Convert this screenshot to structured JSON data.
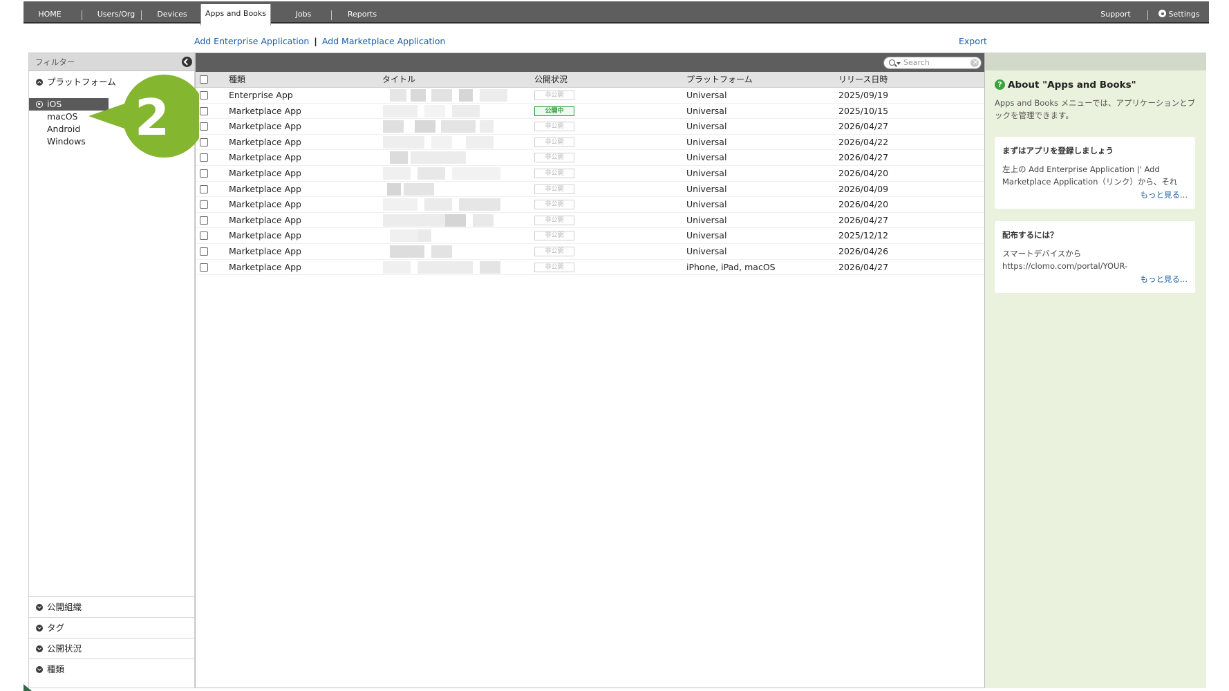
{
  "nav": {
    "items": [
      "HOME",
      "Users/Org",
      "Devices",
      "Apps and Books",
      "Jobs",
      "Reports"
    ],
    "active": "Apps and Books",
    "support": "Support",
    "settings": "Settings"
  },
  "actions": {
    "add_enterprise": "Add Enterprise Application",
    "add_marketplace": "Add Marketplace Application",
    "separator": "|",
    "export": "Export"
  },
  "filter": {
    "title": "フィルター",
    "platform_section": "プラットフォーム",
    "platforms": [
      "iOS",
      "macOS",
      "Android",
      "Windows"
    ],
    "selected_platform": "iOS",
    "bottom_sections": [
      "公開組織",
      "タグ",
      "公開状況",
      "種類"
    ]
  },
  "callout": {
    "number": "2",
    "color": "#84b62f"
  },
  "table": {
    "search_placeholder": "Search",
    "columns": [
      "種類",
      "タイトル",
      "公開状況",
      "プラットフォーム",
      "リリース日時"
    ],
    "rows": [
      {
        "type": "Enterprise App",
        "status": "非公開",
        "status_on": false,
        "platform": "Universal",
        "date": "2025/09/19"
      },
      {
        "type": "Marketplace App",
        "status": "公開中",
        "status_on": true,
        "platform": "Universal",
        "date": "2025/10/15"
      },
      {
        "type": "Marketplace App",
        "status": "非公開",
        "status_on": false,
        "platform": "Universal",
        "date": "2026/04/27"
      },
      {
        "type": "Marketplace App",
        "status": "非公開",
        "status_on": false,
        "platform": "Universal",
        "date": "2026/04/22"
      },
      {
        "type": "Marketplace App",
        "status": "非公開",
        "status_on": false,
        "platform": "Universal",
        "date": "2026/04/27"
      },
      {
        "type": "Marketplace App",
        "status": "非公開",
        "status_on": false,
        "platform": "Universal",
        "date": "2026/04/20"
      },
      {
        "type": "Marketplace App",
        "status": "非公開",
        "status_on": false,
        "platform": "Universal",
        "date": "2026/04/09"
      },
      {
        "type": "Marketplace App",
        "status": "非公開",
        "status_on": false,
        "platform": "Universal",
        "date": "2026/04/20"
      },
      {
        "type": "Marketplace App",
        "status": "非公開",
        "status_on": false,
        "platform": "Universal",
        "date": "2026/04/27"
      },
      {
        "type": "Marketplace App",
        "status": "非公開",
        "status_on": false,
        "platform": "Universal",
        "date": "2025/12/12"
      },
      {
        "type": "Marketplace App",
        "status": "非公開",
        "status_on": false,
        "platform": "Universal",
        "date": "2026/04/26"
      },
      {
        "type": "Marketplace App",
        "status": "非公開",
        "status_on": false,
        "platform": "iPhone, iPad, macOS",
        "date": "2026/04/27"
      }
    ]
  },
  "info": {
    "about_title": "About \"Apps and Books\"",
    "about_desc": "Apps and Books メニューでは、アプリケーションとブックを管理できます。",
    "cards": [
      {
        "title": "まずはアプリを登録しましょう",
        "body": "左上の Add Enterprise Application |' Add Marketplace Application（リンク）から、それ",
        "more": "もっと見る..."
      },
      {
        "title": "配布するには？",
        "body": "スマートデバイスから https://clomo.com/portal/YOUR-",
        "more": "もっと見る..."
      }
    ]
  }
}
